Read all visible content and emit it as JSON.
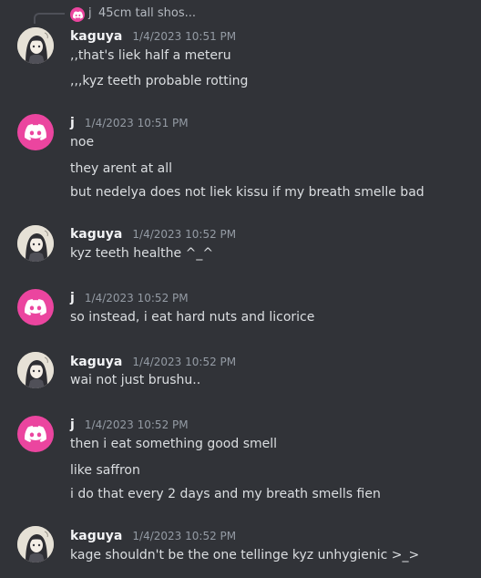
{
  "reply": {
    "author": "j",
    "preview": "45cm tall shos..."
  },
  "messages": [
    {
      "author": "kaguya",
      "avatar": "kaguya-avatar",
      "timestamp": "1/4/2023 10:51 PM",
      "lines": [
        ",,that's liek half a meteru",
        ",,,kyz teeth probable rotting"
      ]
    },
    {
      "author": "j",
      "avatar": "discord-logo-icon",
      "timestamp": "1/4/2023 10:51 PM",
      "lines": [
        "noe",
        "they arent at all",
        "but nedelya does not liek kissu if my breath smelle bad"
      ]
    },
    {
      "author": "kaguya",
      "avatar": "kaguya-avatar",
      "timestamp": "1/4/2023 10:52 PM",
      "lines": [
        "kyz teeth healthe ^_^"
      ]
    },
    {
      "author": "j",
      "avatar": "discord-logo-icon",
      "timestamp": "1/4/2023 10:52 PM",
      "lines": [
        "so instead, i eat hard nuts and licorice"
      ]
    },
    {
      "author": "kaguya",
      "avatar": "kaguya-avatar",
      "timestamp": "1/4/2023 10:52 PM",
      "lines": [
        "wai not just brushu.."
      ]
    },
    {
      "author": "j",
      "avatar": "discord-logo-icon",
      "timestamp": "1/4/2023 10:52 PM",
      "lines": [
        "then i eat something good smell",
        "like saffron",
        "i do that every 2 days and my breath smells fien"
      ]
    },
    {
      "author": "kaguya",
      "avatar": "kaguya-avatar",
      "timestamp": "1/4/2023 10:52 PM",
      "lines": [
        "kage shouldn't be the one tellinge kyz unhygienic >_>"
      ]
    }
  ],
  "colors": {
    "background": "#313338",
    "discord_pink": "#eb459f",
    "username": "#f2f3f5",
    "message_text": "#dbdee1",
    "timestamp": "#949ba4"
  }
}
